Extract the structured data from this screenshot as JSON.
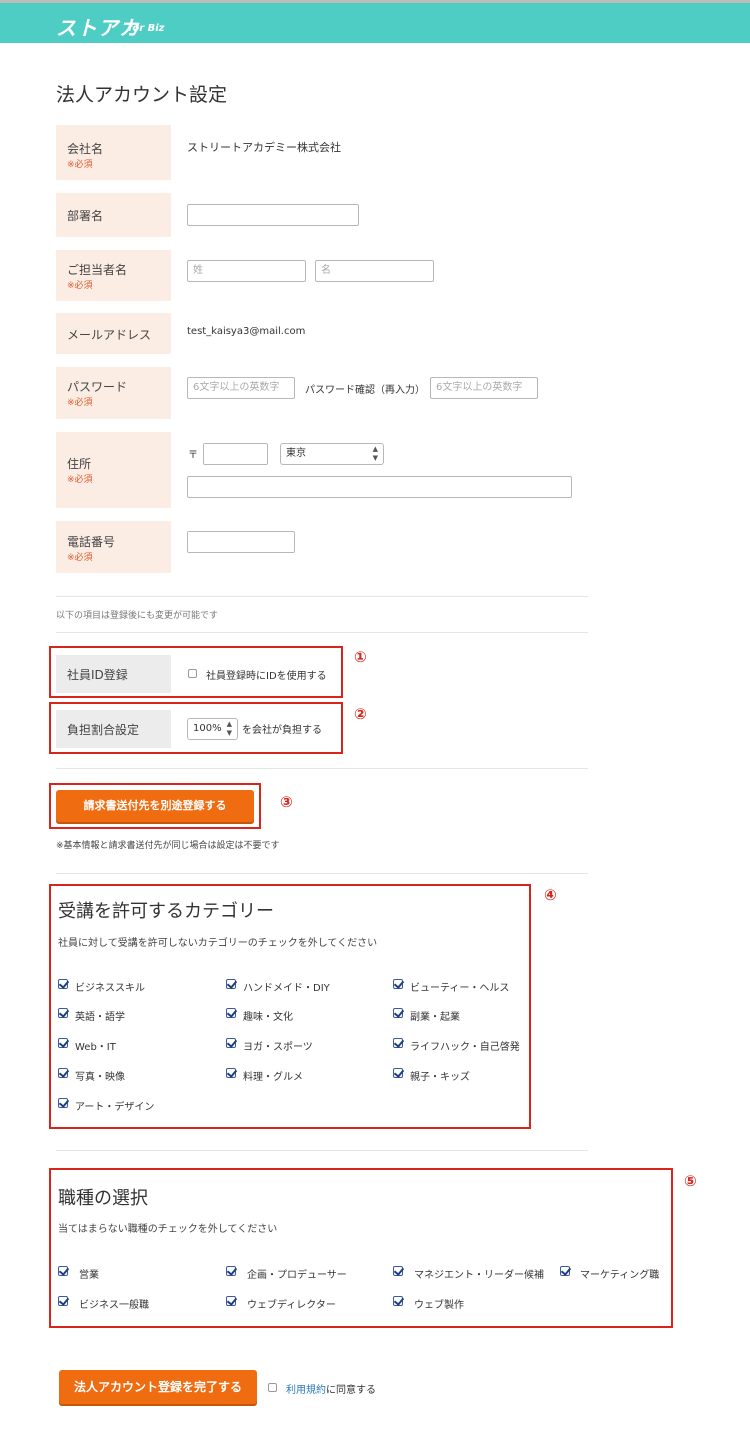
{
  "header": {
    "logo": "ストアカ",
    "logo_sub": "for Biz"
  },
  "page_title": "法人アカウント設定",
  "required_mark": "※必須",
  "form": {
    "company": {
      "label": "会社名",
      "value": "ストリートアカデミー株式会社"
    },
    "department": {
      "label": "部署名",
      "value": ""
    },
    "person": {
      "label": "ご担当者名",
      "last_placeholder": "姓",
      "first_placeholder": "名"
    },
    "email": {
      "label": "メールアドレス",
      "value": "test_kaisya3@mail.com"
    },
    "password": {
      "label": "パスワード",
      "placeholder": "6文字以上の英数字",
      "confirm_label": "パスワード確認（再入力）",
      "confirm_placeholder": "6文字以上の英数字"
    },
    "address": {
      "label": "住所",
      "postal_mark": "〒",
      "prefecture": "東京"
    },
    "phone": {
      "label": "電話番号"
    }
  },
  "editable_note": "以下の項目は登録後にも変更が可能です",
  "employee_id": {
    "label": "社員ID登録",
    "checkbox_label": "社員登録時にIDを使用する",
    "marker": "①"
  },
  "burden": {
    "label": "負担割合設定",
    "value": "100%",
    "suffix": "を会社が負担する",
    "marker": "②"
  },
  "invoice": {
    "button": "請求書送付先を別途登録する",
    "note": "※基本情報と請求書送付先が同じ場合は設定は不要です",
    "marker": "③"
  },
  "categories": {
    "title": "受講を許可するカテゴリー",
    "desc": "社員に対して受講を許可しないカテゴリーのチェックを外してください",
    "marker": "④",
    "items": [
      "ビジネススキル",
      "ハンドメイド・DIY",
      "ビューティー・ヘルス",
      "英語・語学",
      "趣味・文化",
      "副業・起業",
      "Web・IT",
      "ヨガ・スポーツ",
      "ライフハック・自己啓発",
      "写真・映像",
      "料理・グルメ",
      "親子・キッズ",
      "アート・デザイン"
    ]
  },
  "jobs": {
    "title": "職種の選択",
    "desc": "当てはまらない職種のチェックを外してください",
    "marker": "⑤",
    "items": [
      "営業",
      "企画・プロデューサー",
      "マネジエント・リーダー候補",
      "マーケティング職",
      "ビジネス一般職",
      "ウェブディレクター",
      "ウェブ製作"
    ]
  },
  "footer": {
    "submit": "法人アカウント登録を完了する",
    "terms_link": "利用規約",
    "terms_suffix": "に同意する"
  }
}
